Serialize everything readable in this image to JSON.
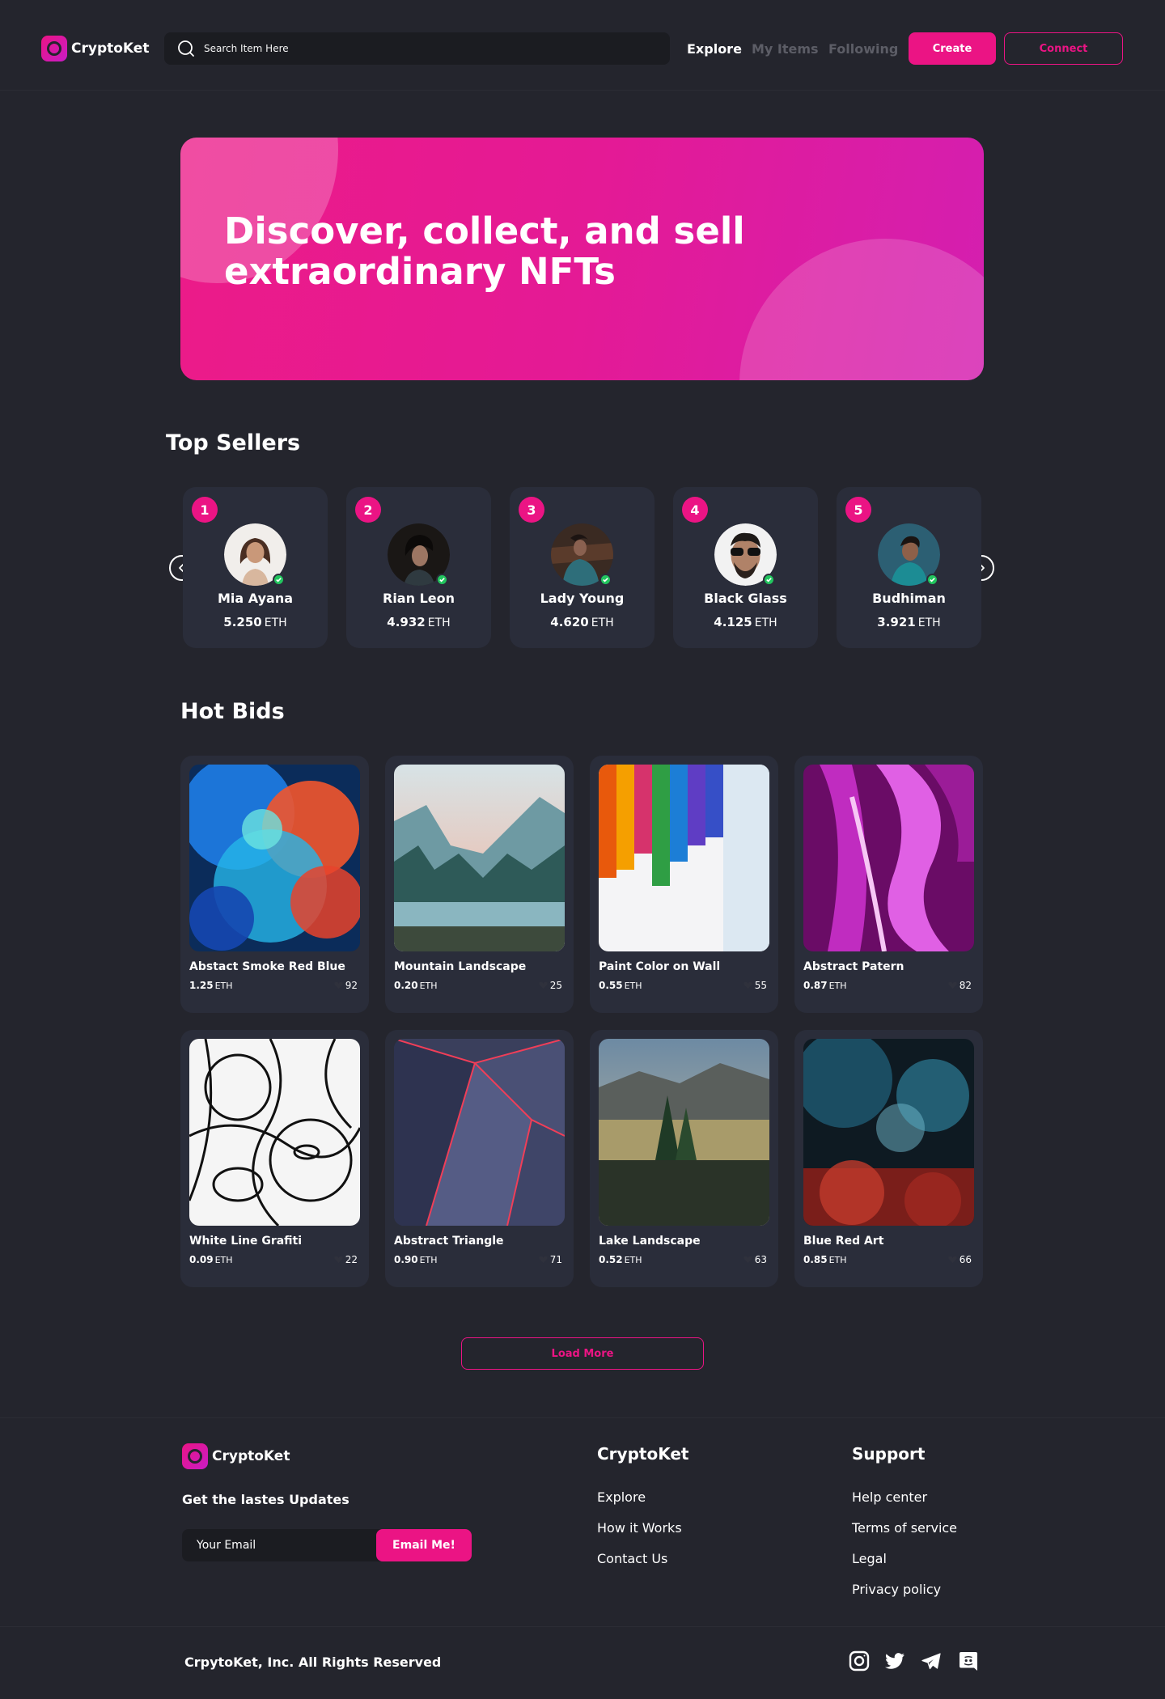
{
  "brand": {
    "name": "CryptoKet",
    "accent": "#EB1484",
    "background": "#24252D",
    "card": "#2A2D3A"
  },
  "header": {
    "search_placeholder": "Search Item Here",
    "nav": [
      {
        "label": "Explore",
        "active": true
      },
      {
        "label": "My Items",
        "active": false
      },
      {
        "label": "Following",
        "active": false
      }
    ],
    "create_label": "Create",
    "connect_label": "Connect"
  },
  "hero": {
    "line1": "Discover, collect, and sell",
    "line2": "extraordinary NFTs"
  },
  "top_sellers": {
    "title": "Top Sellers",
    "currency": "ETH",
    "items": [
      {
        "rank": "1",
        "name": "Mia Ayana",
        "price": "5.250"
      },
      {
        "rank": "2",
        "name": "Rian Leon",
        "price": "4.932"
      },
      {
        "rank": "3",
        "name": "Lady Young",
        "price": "4.620"
      },
      {
        "rank": "4",
        "name": "Black Glass",
        "price": "4.125"
      },
      {
        "rank": "5",
        "name": "Budhiman",
        "price": "3.921"
      }
    ]
  },
  "hot_bids": {
    "title": "Hot Bids",
    "currency": "ETH",
    "items": [
      {
        "name": "Abstact Smoke Red Blue",
        "price": "1.25",
        "likes": "92"
      },
      {
        "name": "Mountain Landscape",
        "price": "0.20",
        "likes": "25"
      },
      {
        "name": "Paint Color on Wall",
        "price": "0.55",
        "likes": "55"
      },
      {
        "name": "Abstract Patern",
        "price": "0.87",
        "likes": "82"
      },
      {
        "name": "White Line Grafiti",
        "price": "0.09",
        "likes": "22"
      },
      {
        "name": "Abstract Triangle",
        "price": "0.90",
        "likes": "71"
      },
      {
        "name": "Lake Landscape",
        "price": "0.52",
        "likes": "63"
      },
      {
        "name": "Blue Red Art",
        "price": "0.85",
        "likes": "66"
      }
    ],
    "load_more_label": "Load More"
  },
  "footer": {
    "brand": "CryptoKet",
    "updates_label": "Get the lastes Updates",
    "email_placeholder": "Your Email",
    "email_button": "Email Me!",
    "columns": [
      {
        "heading": "CryptoKet",
        "links": [
          "Explore",
          "How it Works",
          "Contact Us"
        ]
      },
      {
        "heading": "Support",
        "links": [
          "Help center",
          "Terms of service",
          "Legal",
          "Privacy policy"
        ]
      }
    ],
    "copyright": "CrpytoKet, Inc. All Rights Reserved",
    "social_icons": [
      "instagram-icon",
      "twitter-icon",
      "telegram-icon",
      "discord-icon"
    ]
  }
}
